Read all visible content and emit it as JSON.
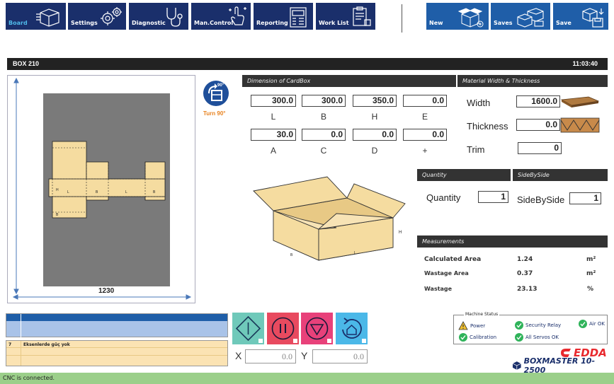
{
  "nav": {
    "items": [
      {
        "label": "Board",
        "icon": "box-icon",
        "active": true
      },
      {
        "label": "Settings",
        "icon": "gears-icon"
      },
      {
        "label": "Diagnostic",
        "icon": "stethoscope-icon"
      },
      {
        "label": "Man.Control",
        "icon": "hand-pointer-icon"
      },
      {
        "label": "Reporting",
        "icon": "report-icon"
      },
      {
        "label": "Work List",
        "icon": "clipboard-icon"
      }
    ],
    "actions": [
      {
        "label": "New",
        "icon": "new-box-icon"
      },
      {
        "label": "Saves",
        "icon": "saves-icon"
      },
      {
        "label": "Save",
        "icon": "save-icon"
      }
    ]
  },
  "header": {
    "title": "BOX 210",
    "time": "11:03:40"
  },
  "preview": {
    "width_label": "1230",
    "turn_label": "Turn 90°",
    "turn_badge": "90°"
  },
  "dimension": {
    "title": "Dimension of CardBox",
    "fields": [
      {
        "label": "L",
        "value": "300.0"
      },
      {
        "label": "B",
        "value": "300.0"
      },
      {
        "label": "H",
        "value": "350.0"
      },
      {
        "label": "E",
        "value": "0.0"
      },
      {
        "label": "A",
        "value": "30.0"
      },
      {
        "label": "C",
        "value": "0.0"
      },
      {
        "label": "D",
        "value": "0.0"
      },
      {
        "label": "+",
        "value": "0.0"
      }
    ]
  },
  "material": {
    "title": "Material Width & Thickness",
    "width_label": "Width",
    "width_value": "1600.0",
    "thickness_label": "Thickness",
    "thickness_value": "0.0",
    "trim_label": "Trim",
    "trim_value": "0"
  },
  "quantity": {
    "title": "Quantity",
    "label": "Quantity",
    "value": "1"
  },
  "sidebyside": {
    "title": "SideBySide",
    "label": "SideBySide",
    "value": "1"
  },
  "measurements": {
    "title": "Measurements",
    "rows": [
      {
        "label": "Calculated Area",
        "value": "1.24",
        "unit": "m²"
      },
      {
        "label": "Wastage Area",
        "value": "0.37",
        "unit": "m²"
      },
      {
        "label": "Wastage",
        "value": "23.13",
        "unit": "%"
      }
    ]
  },
  "messages": [
    {
      "code": "7",
      "text": "Eksenlerde güç yok"
    }
  ],
  "coords": {
    "x_label": "X",
    "x_value": "0.0",
    "y_label": "Y",
    "y_value": "0.0"
  },
  "machine_status": {
    "title": "Machine Status",
    "items": [
      {
        "label": "Power",
        "state": "warning"
      },
      {
        "label": "Security Relay",
        "state": "ok"
      },
      {
        "label": "Air OK",
        "state": "ok"
      },
      {
        "label": "Calibration",
        "state": "ok"
      },
      {
        "label": "All Servos OK",
        "state": "ok"
      }
    ]
  },
  "brand": {
    "logo": "EDDA",
    "product": "BOXMASTER 10-2500"
  },
  "statusbar": {
    "text": "CNC is connected."
  },
  "diagram_labels": {
    "l": "L",
    "b": "B",
    "h": "H",
    "side_h": "H",
    "box_l": "L",
    "box_b": "B"
  },
  "colors": {
    "nav": "#1a2f6b",
    "accent": "#e8292e",
    "ok": "#2fb35a",
    "cardboard": "#f5dca0"
  }
}
